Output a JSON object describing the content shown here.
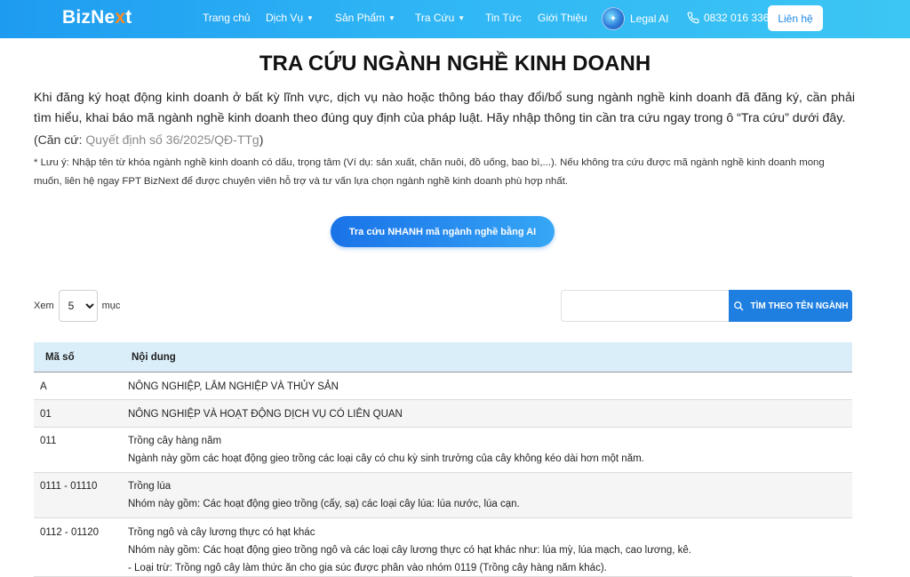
{
  "header": {
    "logo_part1": "BizNe",
    "logo_part2": "x",
    "logo_part3": "t",
    "nav": [
      {
        "label": "Trang chủ",
        "dropdown": false
      },
      {
        "label": "Dịch Vụ",
        "dropdown": true
      },
      {
        "label": "Sản Phẩm",
        "dropdown": true
      },
      {
        "label": "Tra Cứu",
        "dropdown": true
      },
      {
        "label": "Tin Tức",
        "dropdown": false
      },
      {
        "label": "Giới Thiệu",
        "dropdown": false
      }
    ],
    "legal_ai": "Legal AI",
    "phone": "0832 016 336",
    "contact": "Liên hệ",
    "brand_color": "#1e9bf0",
    "logo_accent_color": "#ff8a1f"
  },
  "main": {
    "title": "TRA CỨU NGÀNH NGHỀ KINH DOANH",
    "intro": "Khi đăng ký hoạt động kinh doanh ở bất kỳ lĩnh vực, dịch vụ nào hoặc thông báo thay đổi/bổ sung ngành nghề kinh doanh đã đăng ký, cần phải tìm hiểu, khai báo mã ngành nghề kinh doanh theo đúng quy định của pháp luật. Hãy nhập thông tin cần tra cứu ngay trong ô “Tra cứu” dưới đây.",
    "basis_prefix": "(Căn cứ: ",
    "basis_link": "Quyết định số 36/2025/QĐ-TTg",
    "basis_suffix": ")",
    "note": "* Lưu ý: Nhập tên từ khóa ngành nghề kinh doanh có dấu, trọng tâm (Ví dụ: sản xuất, chăn nuôi, đồ uống, bao bì,...). Nếu không tra cứu được mã ngành nghề kinh doanh mong muốn, liên hệ ngay FPT BizNext để được chuyên viên hỗ trợ và tư vấn lựa chọn ngành nghề kinh doanh phù hợp nhất.",
    "ai_button": "Tra cứu NHANH mã ngành nghề bằng AI"
  },
  "controls": {
    "show_prefix": "Xem",
    "show_value": "5",
    "show_suffix": "mục",
    "search_placeholder": "",
    "search_button": "TÌM THEO TÊN NGÀNH"
  },
  "table": {
    "headers": [
      "Mã số",
      "Nội dung"
    ],
    "rows": [
      {
        "code": "A",
        "lines": [
          "NÔNG NGHIỆP, LÂM NGHIỆP VÀ THỦY SẢN"
        ]
      },
      {
        "code": "01",
        "lines": [
          "NÔNG NGHIỆP VÀ HOẠT ĐỘNG DỊCH VỤ CÓ LIÊN QUAN"
        ]
      },
      {
        "code": "011",
        "lines": [
          "Trồng cây hàng năm",
          "Ngành này gồm các hoạt động gieo trồng các loại cây có chu kỳ sinh trưởng của cây không kéo dài hơn một năm."
        ]
      },
      {
        "code": "0111 - 01110",
        "lines": [
          "Trồng lúa",
          "Nhóm này gồm: Các hoạt động gieo trồng (cấy, sạ) các loại cây lúa: lúa nước, lúa cạn."
        ]
      },
      {
        "code": "0112 - 01120",
        "lines": [
          "Trồng ngô và cây lương thực có hạt khác",
          "Nhóm này gồm: Các hoạt động gieo trồng ngô và các loại cây lương thực có hạt khác như: lúa mỳ, lúa mạch, cao lương, kê.",
          "- Loại trừ: Trồng ngô cây làm thức ăn cho gia súc được phân vào nhóm 0119 (Trồng cây hàng năm khác)."
        ]
      }
    ]
  }
}
